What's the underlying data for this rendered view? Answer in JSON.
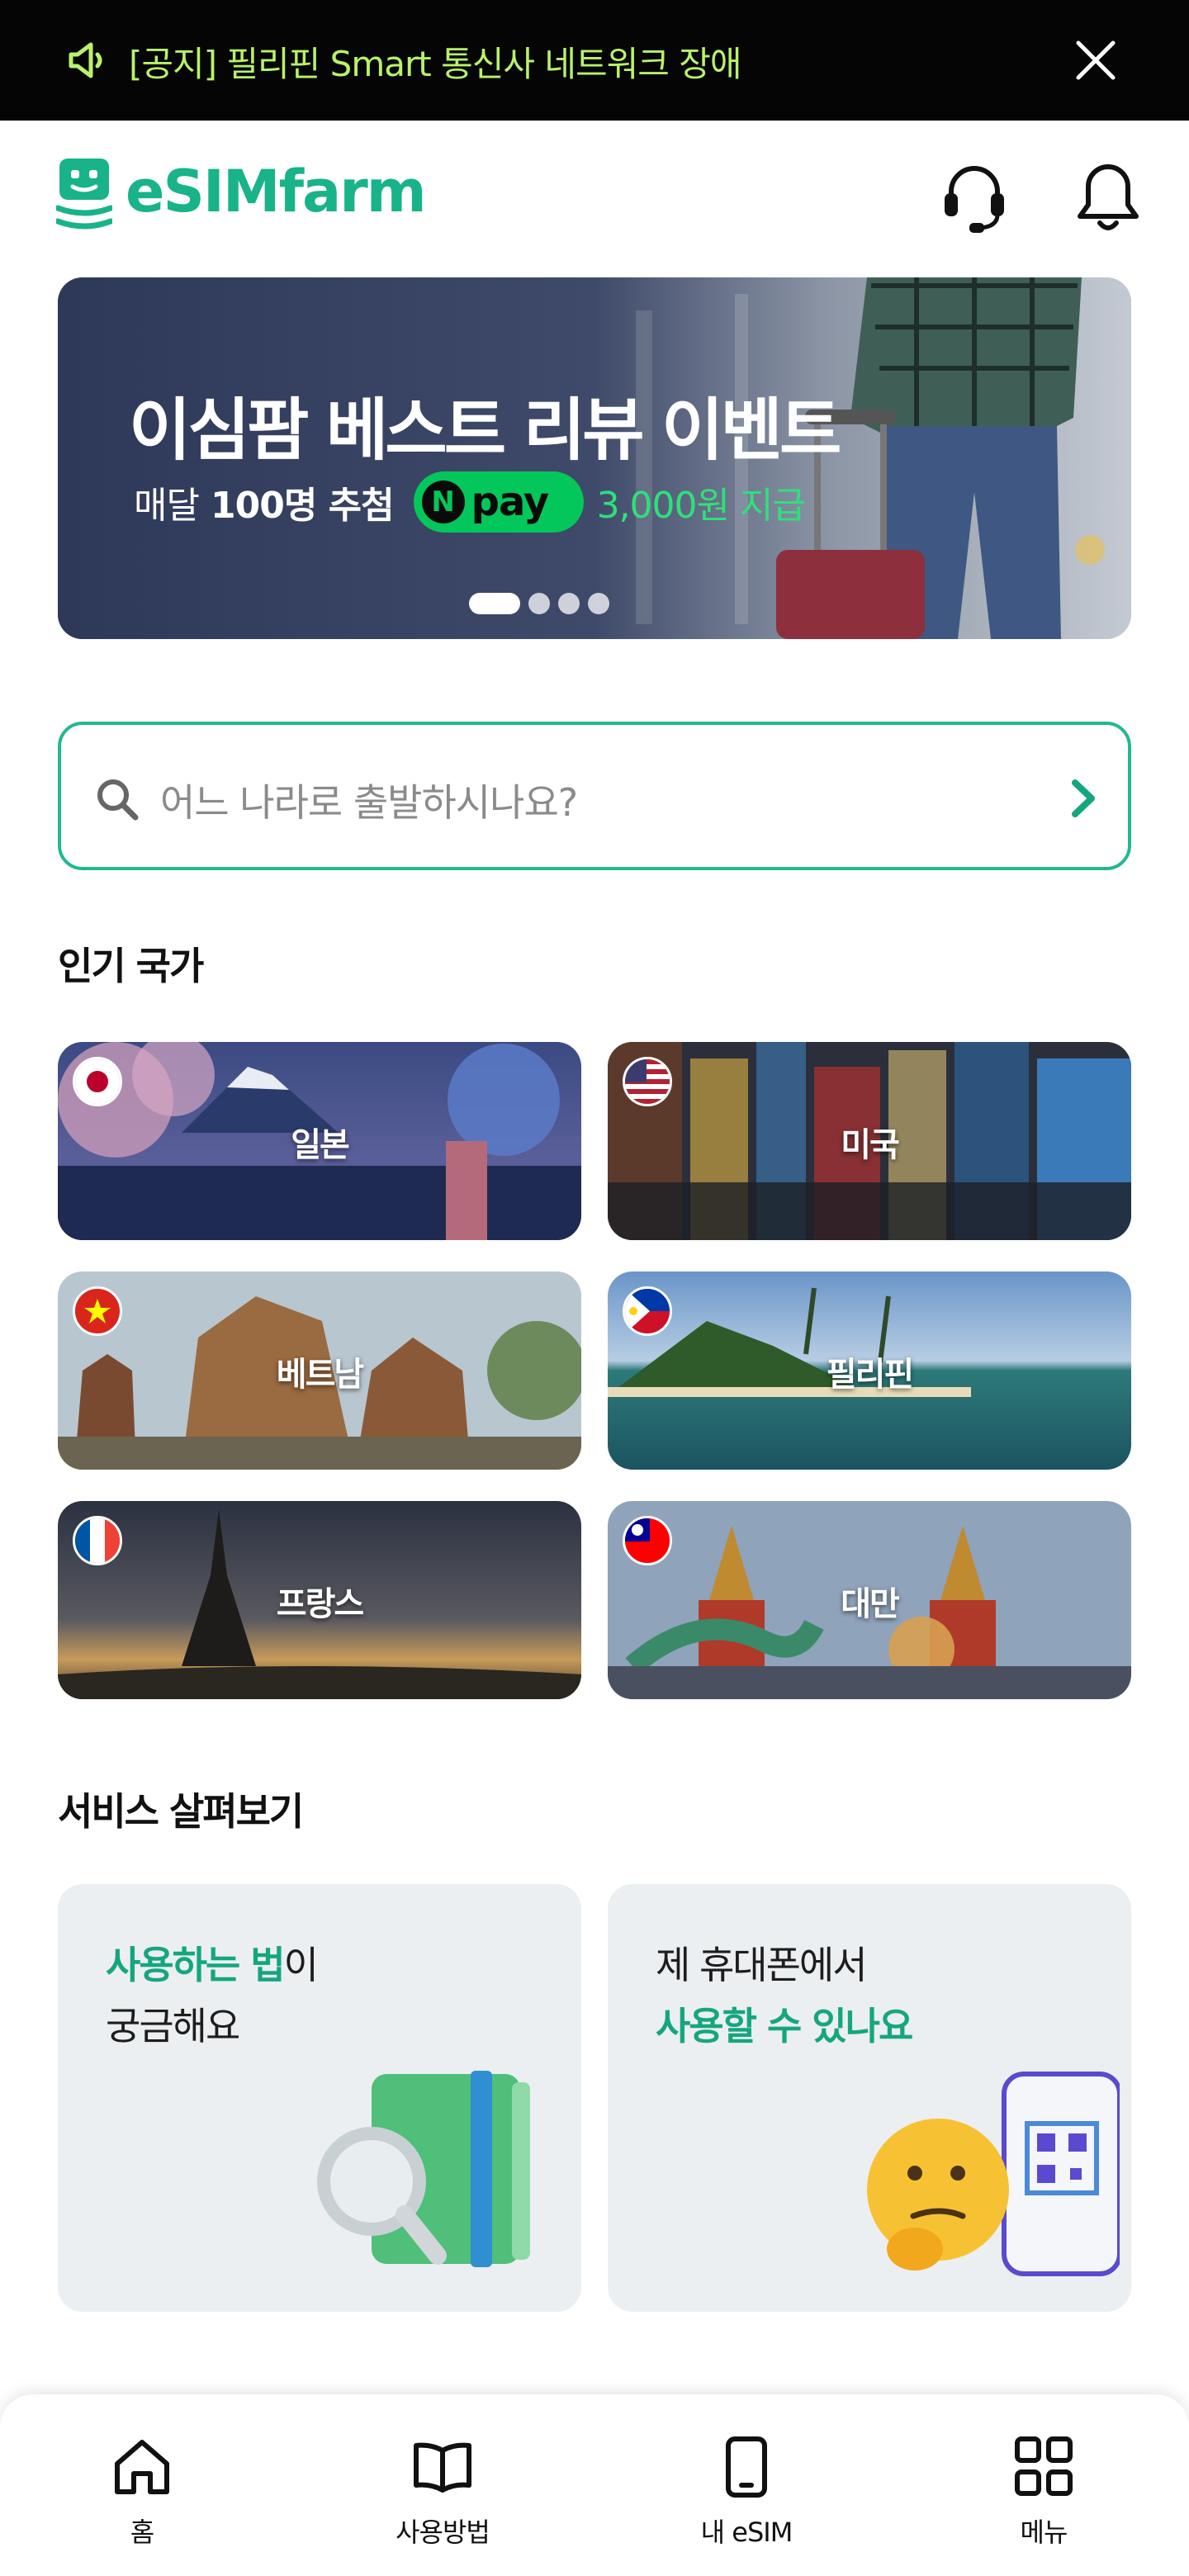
{
  "notice": {
    "text": "[공지] 필리핀 Smart 통신사 네트워크 장애",
    "icon": "speaker-icon",
    "close_icon": "close-icon",
    "text_color": "#b8f26a"
  },
  "header": {
    "logo_text": "eSIMfarm",
    "brand_color": "#19b389",
    "support_icon": "headset-icon",
    "notification_icon": "bell-icon"
  },
  "banner": {
    "title": "이심팜 베스트 리뷰 이벤트",
    "sub_prefix": "매달",
    "sub_bold": "100명 추첨",
    "npay_n": "N",
    "npay_word": "pay",
    "sub_reward": "3,000원 지급",
    "slide_count": 4,
    "active_slide": 1
  },
  "search": {
    "placeholder": "어느 나라로 출발하시나요?",
    "accent": "#22b893"
  },
  "popular": {
    "title": "인기 국가",
    "countries": [
      {
        "name": "일본",
        "flag": "japan-flag-icon"
      },
      {
        "name": "미국",
        "flag": "usa-flag-icon"
      },
      {
        "name": "베트남",
        "flag": "vietnam-flag-icon"
      },
      {
        "name": "필리핀",
        "flag": "philippines-flag-icon"
      },
      {
        "name": "프랑스",
        "flag": "france-flag-icon"
      },
      {
        "name": "대만",
        "flag": "taiwan-flag-icon"
      }
    ]
  },
  "services": {
    "title": "서비스 살펴보기",
    "cards": [
      {
        "line1_green": "사용하는 법",
        "line1_rest": "이",
        "line2": "궁금해요",
        "art": "guidebook-magnifier-icon"
      },
      {
        "line1": "제 휴대폰에서",
        "line2_green": "사용할 수 있나요",
        "art": "thinking-emoji-phone-qr-icon"
      }
    ]
  },
  "nav": {
    "items": [
      {
        "label": "홈",
        "icon": "home-icon"
      },
      {
        "label": "사용방법",
        "icon": "book-icon"
      },
      {
        "label": "내 eSIM",
        "icon": "phone-icon"
      },
      {
        "label": "메뉴",
        "icon": "grid-menu-icon"
      }
    ]
  }
}
